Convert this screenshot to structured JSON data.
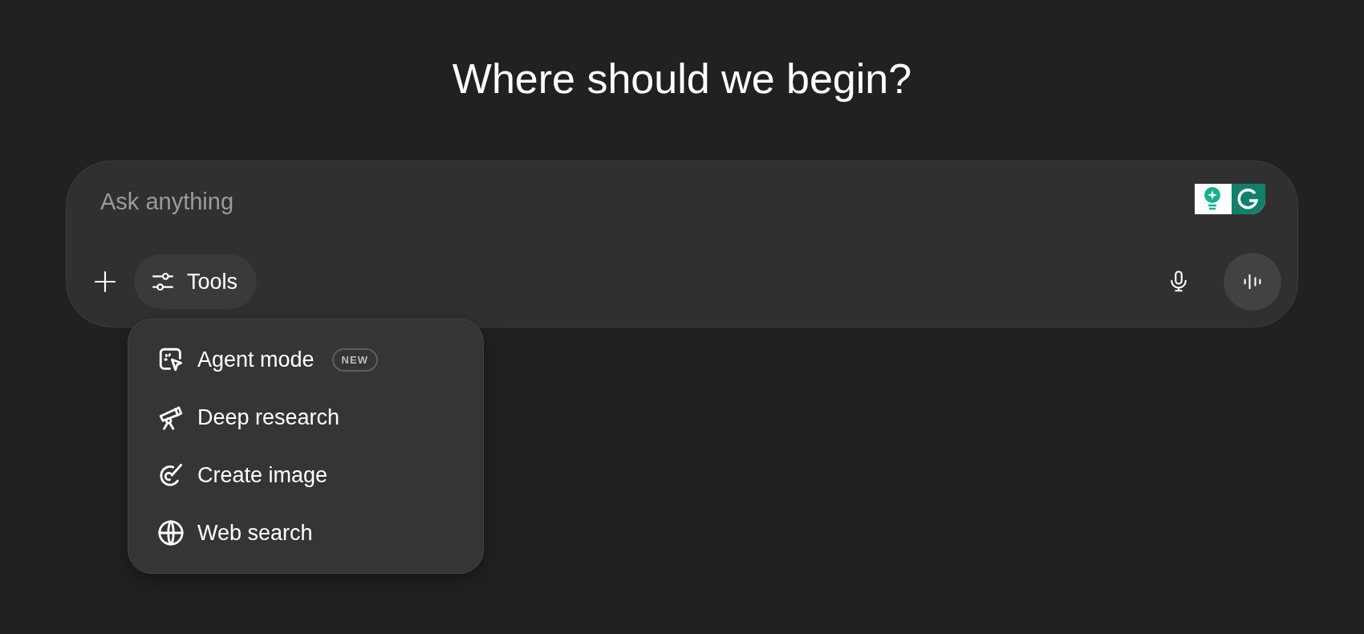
{
  "heading": "Where should we begin?",
  "composer": {
    "placeholder": "Ask anything",
    "tools_button": "Tools"
  },
  "tools_menu": [
    {
      "label": "Agent mode",
      "badge": "NEW"
    },
    {
      "label": "Deep research"
    },
    {
      "label": "Create image"
    },
    {
      "label": "Web search"
    }
  ]
}
